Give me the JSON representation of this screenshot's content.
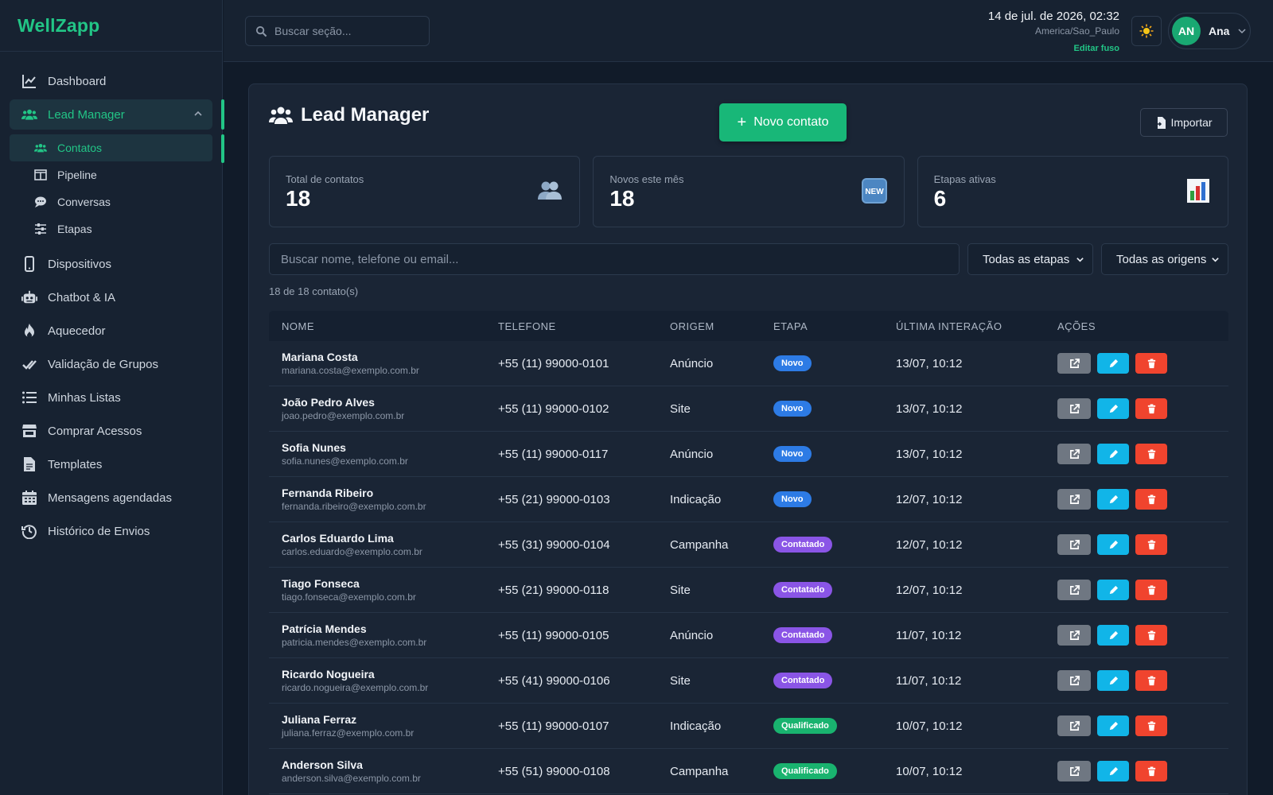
{
  "brand": "WellZapp",
  "sidebar": {
    "items": [
      {
        "label": "Dashboard",
        "icon": "chart-line-icon"
      },
      {
        "label": "Lead Manager",
        "icon": "users-icon"
      },
      {
        "label": "Dispositivos",
        "icon": "mobile-icon"
      },
      {
        "label": "Chatbot & IA",
        "icon": "robot-icon"
      },
      {
        "label": "Aquecedor",
        "icon": "fire-icon"
      },
      {
        "label": "Validação de Grupos",
        "icon": "check-double-icon"
      },
      {
        "label": "Minhas Listas",
        "icon": "list-icon"
      },
      {
        "label": "Comprar Acessos",
        "icon": "store-icon"
      },
      {
        "label": "Templates",
        "icon": "file-icon"
      },
      {
        "label": "Mensagens agendadas",
        "icon": "calendar-icon"
      },
      {
        "label": "Histórico de Envios",
        "icon": "history-icon"
      }
    ],
    "sub_items": [
      {
        "label": "Contatos",
        "icon": "users-icon"
      },
      {
        "label": "Pipeline",
        "icon": "columns-icon"
      },
      {
        "label": "Conversas",
        "icon": "chat-icon"
      },
      {
        "label": "Etapas",
        "icon": "sliders-icon"
      }
    ]
  },
  "header": {
    "search_placeholder": "Buscar seção...",
    "datetime": "14 de jul. de 2026, 02:32",
    "timezone": "America/Sao_Paulo",
    "edit_tz": "Editar fuso",
    "theme_icon": "sun-icon",
    "avatar_initials": "AN",
    "user_name": "Ana"
  },
  "page": {
    "title": "Lead Manager",
    "new_contact": "Novo contato",
    "import": "Importar"
  },
  "stats": [
    {
      "label": "Total de contatos",
      "value": "18",
      "icon": "people-emoji-icon"
    },
    {
      "label": "Novos este mês",
      "value": "18",
      "icon": "new-emoji-icon"
    },
    {
      "label": "Etapas ativas",
      "value": "6",
      "icon": "bar-chart-emoji-icon"
    }
  ],
  "filters": {
    "search_placeholder": "Buscar nome, telefone ou email...",
    "stage_select": "Todas as etapas",
    "origin_select": "Todas as origens"
  },
  "count_text": "18 de 18 contato(s)",
  "table": {
    "headers": [
      "NOME",
      "TELEFONE",
      "ORIGEM",
      "ETAPA",
      "ÚLTIMA INTERAÇÃO",
      "AÇÕES"
    ],
    "rows": [
      {
        "name": "Mariana Costa",
        "email": "mariana.costa@exemplo.com.br",
        "phone": "+55 (11) 99000-0101",
        "origin": "Anúncio",
        "stage": "Novo",
        "last": "13/07, 10:12"
      },
      {
        "name": "João Pedro Alves",
        "email": "joao.pedro@exemplo.com.br",
        "phone": "+55 (11) 99000-0102",
        "origin": "Site",
        "stage": "Novo",
        "last": "13/07, 10:12"
      },
      {
        "name": "Sofia Nunes",
        "email": "sofia.nunes@exemplo.com.br",
        "phone": "+55 (11) 99000-0117",
        "origin": "Anúncio",
        "stage": "Novo",
        "last": "13/07, 10:12"
      },
      {
        "name": "Fernanda Ribeiro",
        "email": "fernanda.ribeiro@exemplo.com.br",
        "phone": "+55 (21) 99000-0103",
        "origin": "Indicação",
        "stage": "Novo",
        "last": "12/07, 10:12"
      },
      {
        "name": "Carlos Eduardo Lima",
        "email": "carlos.eduardo@exemplo.com.br",
        "phone": "+55 (31) 99000-0104",
        "origin": "Campanha",
        "stage": "Contatado",
        "last": "12/07, 10:12"
      },
      {
        "name": "Tiago Fonseca",
        "email": "tiago.fonseca@exemplo.com.br",
        "phone": "+55 (21) 99000-0118",
        "origin": "Site",
        "stage": "Contatado",
        "last": "12/07, 10:12"
      },
      {
        "name": "Patrícia Mendes",
        "email": "patricia.mendes@exemplo.com.br",
        "phone": "+55 (11) 99000-0105",
        "origin": "Anúncio",
        "stage": "Contatado",
        "last": "11/07, 10:12"
      },
      {
        "name": "Ricardo Nogueira",
        "email": "ricardo.nogueira@exemplo.com.br",
        "phone": "+55 (41) 99000-0106",
        "origin": "Site",
        "stage": "Contatado",
        "last": "11/07, 10:12"
      },
      {
        "name": "Juliana Ferraz",
        "email": "juliana.ferraz@exemplo.com.br",
        "phone": "+55 (11) 99000-0107",
        "origin": "Indicação",
        "stage": "Qualificado",
        "last": "10/07, 10:12"
      },
      {
        "name": "Anderson Silva",
        "email": "anderson.silva@exemplo.com.br",
        "phone": "+55 (51) 99000-0108",
        "origin": "Campanha",
        "stage": "Qualificado",
        "last": "10/07, 10:12"
      }
    ]
  },
  "colors": {
    "accent": "#22c586",
    "stage_novo": "#2d7be5",
    "stage_contatado": "#8a55e6",
    "stage_qualificado": "#19b36f",
    "btn_open": "#6f7782",
    "btn_edit": "#11b5e8",
    "btn_delete": "#f0442e"
  }
}
